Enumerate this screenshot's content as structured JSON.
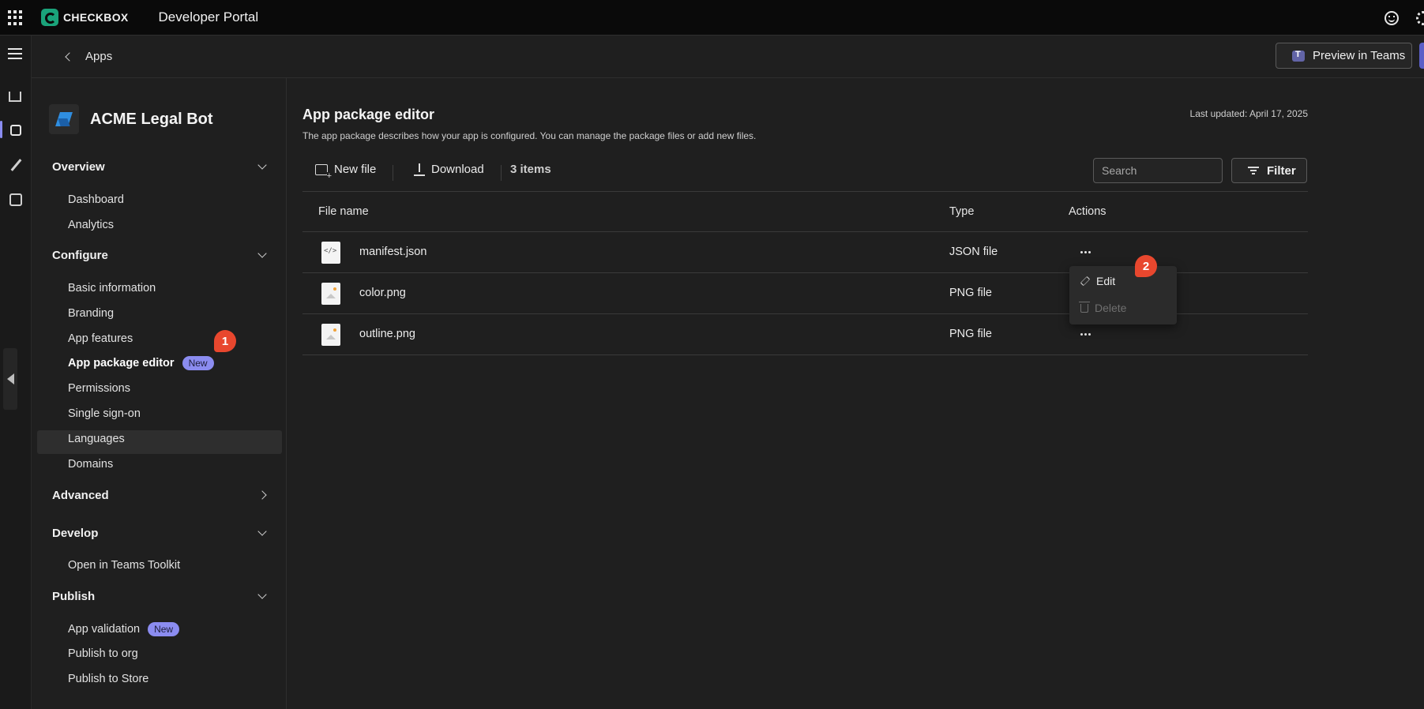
{
  "topbar": {
    "brand": "CHECKBOX",
    "portal_title": "Developer Portal"
  },
  "subheader": {
    "back_label": "Apps",
    "preview_label": "Preview in Teams"
  },
  "app": {
    "name": "ACME Legal Bot"
  },
  "sidebar": {
    "overview": {
      "label": "Overview",
      "items": [
        "Dashboard",
        "Analytics"
      ]
    },
    "configure": {
      "label": "Configure",
      "items": [
        "Basic information",
        "Branding",
        "App features",
        "App package editor",
        "Permissions",
        "Single sign-on",
        "Languages",
        "Domains"
      ]
    },
    "advanced": {
      "label": "Advanced"
    },
    "develop": {
      "label": "Develop",
      "items": [
        "Open in Teams Toolkit"
      ]
    },
    "publish": {
      "label": "Publish",
      "items": [
        "App validation",
        "Publish to org",
        "Publish to Store"
      ]
    },
    "new_badge": "New"
  },
  "markers": {
    "one": "1",
    "two": "2"
  },
  "main": {
    "title": "App package editor",
    "description": "The app package describes how your app is configured. You can manage the package files or add new files.",
    "last_updated": "Last updated: April 17, 2025",
    "toolbar": {
      "new_file": "New file",
      "download": "Download",
      "items_count": "3 items",
      "search_placeholder": "Search",
      "filter": "Filter"
    },
    "table": {
      "headers": {
        "name": "File name",
        "type": "Type",
        "actions": "Actions"
      },
      "rows": [
        {
          "name": "manifest.json",
          "type": "JSON file",
          "icon": "json-file-icon"
        },
        {
          "name": "color.png",
          "type": "PNG file",
          "icon": "image-file-icon"
        },
        {
          "name": "outline.png",
          "type": "PNG file",
          "icon": "image-file-icon"
        }
      ]
    },
    "menu": {
      "edit": "Edit",
      "delete": "Delete"
    }
  }
}
